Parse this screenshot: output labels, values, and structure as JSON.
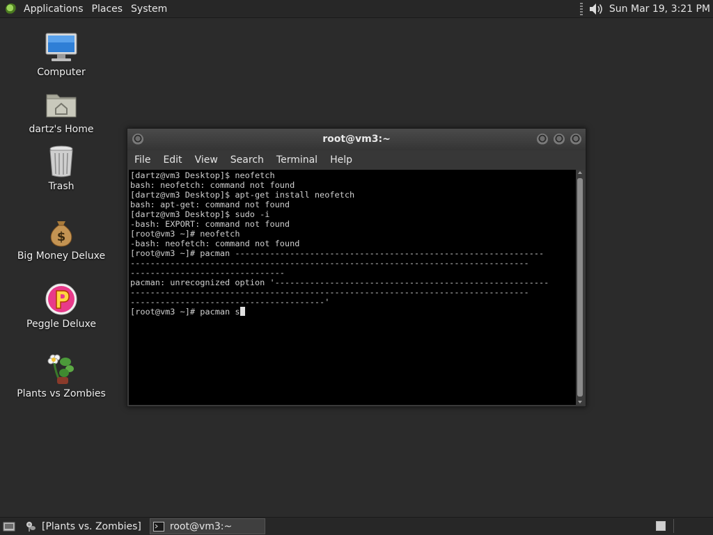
{
  "top_panel": {
    "menus": [
      "Applications",
      "Places",
      "System"
    ],
    "clock": "Sun Mar 19,  3:21 PM"
  },
  "desktop_icons": [
    {
      "label": "Computer",
      "icon": "computer-icon"
    },
    {
      "label": "dartz's Home",
      "icon": "home-folder-icon"
    },
    {
      "label": "Trash",
      "icon": "trash-icon"
    },
    {
      "label": "Big Money Deluxe",
      "icon": "money-bag-icon"
    },
    {
      "label": "Peggle Deluxe",
      "icon": "peggle-icon"
    },
    {
      "label": "Plants vs Zombies",
      "icon": "plants-vs-zombies-icon"
    }
  ],
  "terminal_window": {
    "title": "root@vm3:~",
    "menu": [
      "File",
      "Edit",
      "View",
      "Search",
      "Terminal",
      "Help"
    ],
    "lines": [
      "[dartz@vm3 Desktop]$ neofetch",
      "bash: neofetch: command not found",
      "[dartz@vm3 Desktop]$ apt-get install neofetch",
      "bash: apt-get: command not found",
      "[dartz@vm3 Desktop]$ sudo -i",
      "-bash: EXPORT: command not found",
      "[root@vm3 ~]# neofetch",
      "-bash: neofetch: command not found",
      "[root@vm3 ~]# pacman --------------------------------------------------------------",
      "--------------------------------------------------------------------------------",
      "-------------------------------",
      "pacman: unrecognized option '-------------------------------------------------------",
      "--------------------------------------------------------------------------------",
      "---------------------------------------'"
    ],
    "prompt_line": "[root@vm3 ~]# pacman s"
  },
  "bottom_panel": {
    "tasks": [
      {
        "label": "[Plants vs. Zombies]",
        "icon": "plants-vs-zombies-icon",
        "active": false
      },
      {
        "label": "root@vm3:~",
        "icon": "terminal-icon",
        "active": true
      }
    ]
  }
}
